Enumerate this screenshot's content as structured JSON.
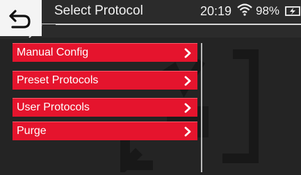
{
  "header": {
    "title": "Select Protocol",
    "time": "20:19",
    "battery": "98%",
    "back_icon": "back-arrow-icon",
    "wifi_icon": "wifi-icon",
    "battery_icon": "battery-charging-icon"
  },
  "menu": {
    "items": [
      {
        "label": "Manual Config"
      },
      {
        "label": "Preset Protocols"
      },
      {
        "label": "User Protocols"
      },
      {
        "label": "Purge"
      }
    ],
    "chevron_icon": "chevron-right-icon"
  },
  "colors": {
    "accent": "#e5142d",
    "background": "#242424",
    "header": "#2b2b2b"
  }
}
